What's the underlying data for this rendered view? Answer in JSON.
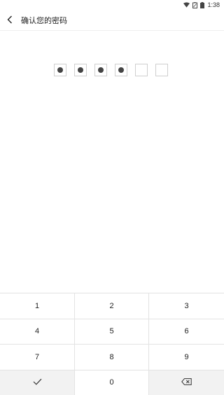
{
  "status_bar": {
    "time": "1:38",
    "icons": [
      "wifi-icon",
      "battery-saver-icon",
      "battery-icon"
    ]
  },
  "header": {
    "title": "确认您的密码",
    "back_icon": "chevron-left-icon"
  },
  "pin": {
    "length": 6,
    "filled": 4
  },
  "keypad": {
    "keys": [
      "1",
      "2",
      "3",
      "4",
      "5",
      "6",
      "7",
      "8",
      "9"
    ],
    "zero": "0",
    "confirm_icon": "check-icon",
    "delete_icon": "backspace-icon"
  },
  "colors": {
    "dot": "#444444",
    "box_border": "#cfcfcf",
    "keypad_gray": "#f2f2f2"
  }
}
